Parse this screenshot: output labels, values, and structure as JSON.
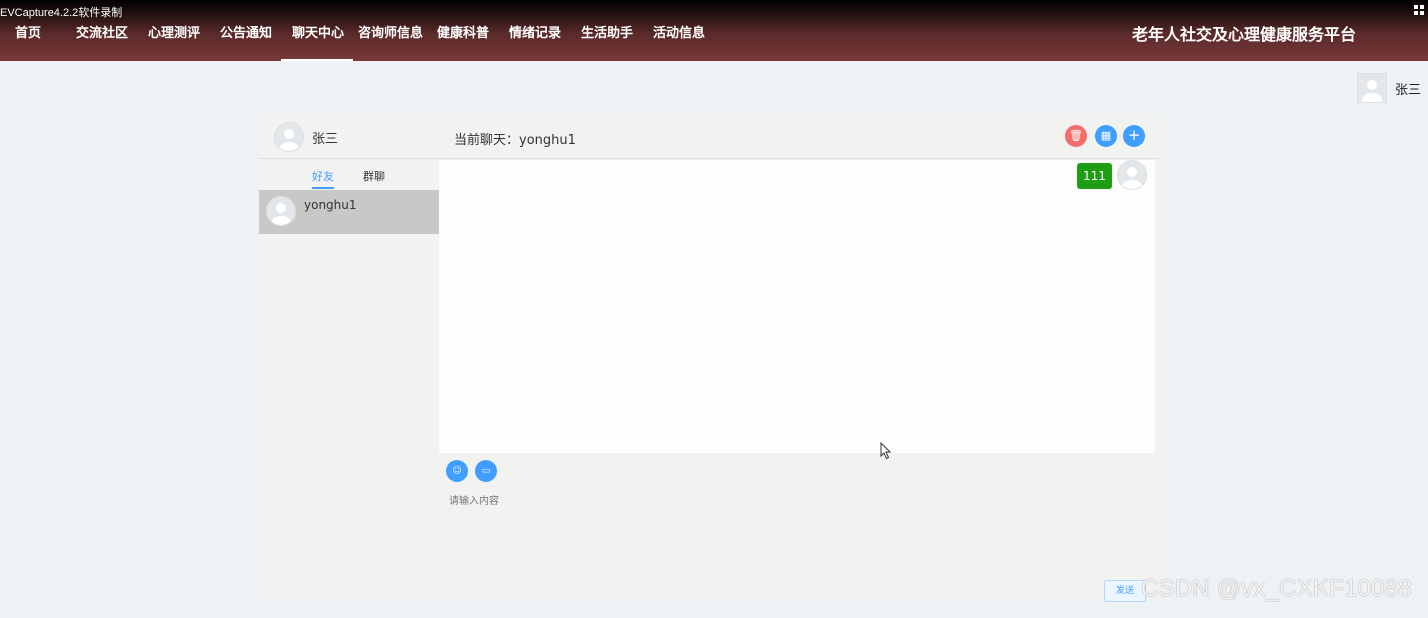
{
  "recorder": {
    "label": "EVCapture4.2.2软件录制",
    "icon": "grid-icon"
  },
  "nav": {
    "items": [
      {
        "label": "首页"
      },
      {
        "label": "交流社区"
      },
      {
        "label": "心理测评"
      },
      {
        "label": "公告通知"
      },
      {
        "label": "聊天中心"
      },
      {
        "label": "咨询师信息"
      },
      {
        "label": "健康科普"
      },
      {
        "label": "情绪记录"
      },
      {
        "label": "生活助手"
      },
      {
        "label": "活动信息"
      }
    ],
    "active": "聊天中心",
    "brand": "老年人社交及心理健康服务平台"
  },
  "user": {
    "name": "张三",
    "icon": "avatar-icon"
  },
  "chat": {
    "me_name": "张三",
    "current_chat": "当前聊天：yonghu1",
    "header_buttons": [
      {
        "icon": "trash-icon",
        "color": "#f56c6c",
        "glyph": "🗑"
      },
      {
        "icon": "list-icon",
        "color": "#409eff",
        "glyph": "▦"
      },
      {
        "icon": "plus-icon",
        "color": "#409eff",
        "glyph": "+"
      }
    ],
    "tabs": {
      "friends": "好友",
      "groups": "群聊"
    },
    "friends": [
      {
        "name": "yonghu1"
      }
    ],
    "messages": [
      {
        "text": "111",
        "from": "self",
        "color": "#1e9e13"
      }
    ],
    "toolbar": {
      "emoji_icon": "emoji-icon",
      "file_icon": "folder-icon"
    },
    "input_placeholder": "请输入内容",
    "send_label": "发送"
  },
  "watermark": "CSDN @vx_CXKF10088",
  "accent": "#409eff"
}
